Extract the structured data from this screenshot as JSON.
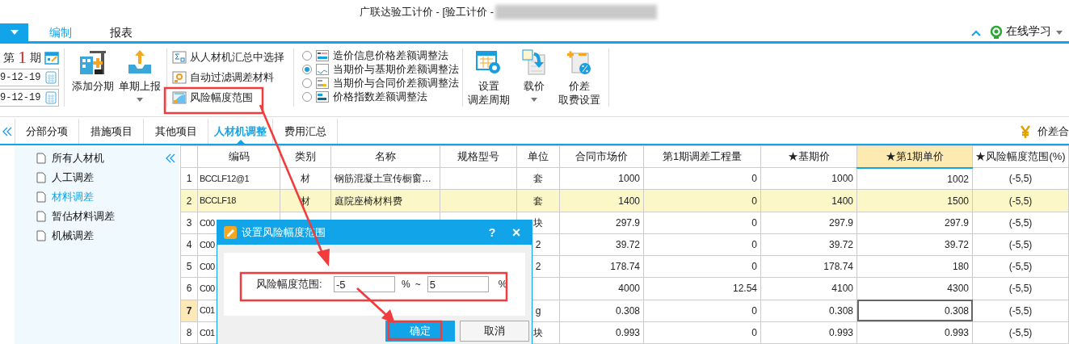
{
  "window": {
    "title": "广联达验工计价 - [验工计价 -"
  },
  "menu_tabs": [
    {
      "label": "编制",
      "selected": true
    },
    {
      "label": "报表",
      "selected": false
    }
  ],
  "help": {
    "label": "在线学习"
  },
  "ribbon": {
    "period": {
      "prefix": "第",
      "number": "1",
      "suffix": "期",
      "dates": [
        "9-12-19",
        "9-12-19"
      ]
    },
    "buttons": [
      {
        "lines": [
          "添加分期"
        ],
        "dropdown": false
      },
      {
        "lines": [
          "单期上报"
        ],
        "dropdown": true
      }
    ],
    "commands": [
      {
        "label": "从人材机汇总中选择"
      },
      {
        "label": "自动过滤调差材料"
      },
      {
        "label": "风险幅度范围"
      }
    ],
    "methods": [
      {
        "label": "造价信息价格差额调整法",
        "selected": false
      },
      {
        "label": "当期价与基期价差额调整法",
        "selected": true
      },
      {
        "label": "当期价与合同价差额调整法",
        "selected": false
      },
      {
        "label": "价格指数差额调整法",
        "selected": false
      }
    ],
    "settings": [
      {
        "lines": [
          "设置",
          "调差周期"
        ],
        "dropdown": false
      },
      {
        "lines": [
          "载价"
        ],
        "dropdown": true
      },
      {
        "lines": [
          "价差",
          "取费设置"
        ],
        "dropdown": false
      }
    ]
  },
  "tabs": [
    {
      "label": "分部分项",
      "selected": false
    },
    {
      "label": "措施项目",
      "selected": false
    },
    {
      "label": "其他项目",
      "selected": false
    },
    {
      "label": "人材机调整",
      "selected": true
    },
    {
      "label": "费用汇总",
      "selected": false
    }
  ],
  "summary": {
    "label": "价差合"
  },
  "sidebar": {
    "items": [
      {
        "label": "所有人材机",
        "selected": false
      },
      {
        "label": "人工调差",
        "selected": false
      },
      {
        "label": "材料调差",
        "selected": true
      },
      {
        "label": "暂估材料调差",
        "selected": false
      },
      {
        "label": "机械调差",
        "selected": false
      }
    ]
  },
  "table": {
    "columns": [
      {
        "label": "编码",
        "selected": false
      },
      {
        "label": "类别",
        "selected": false
      },
      {
        "label": "名称",
        "selected": false
      },
      {
        "label": "规格型号",
        "selected": false
      },
      {
        "label": "单位",
        "selected": false
      },
      {
        "label": "合同市场价",
        "selected": false
      },
      {
        "label": "第1期调差工程量",
        "selected": false
      },
      {
        "label": "★基期价",
        "selected": false
      },
      {
        "label": "★第1期单价",
        "selected": true
      },
      {
        "label": "★风险幅度范围(%)",
        "selected": false
      }
    ],
    "rows": [
      {
        "num": "1",
        "selected": false,
        "current": false,
        "cells": [
          "BCCLF12@1",
          "材",
          "钢筋混凝土宣传橱窗…",
          "",
          "套",
          "1000",
          "0",
          "1000",
          "1002",
          "(-5,5)"
        ]
      },
      {
        "num": "2",
        "selected": true,
        "current": false,
        "cells": [
          "BCCLF18",
          "材",
          "庭院座椅材料费",
          "",
          "套",
          "1400",
          "0",
          "1400",
          "1500",
          "(-5,5)"
        ]
      },
      {
        "num": "3",
        "selected": false,
        "current": false,
        "cells": [
          "C00",
          null,
          null,
          null,
          "块",
          "297.9",
          "0",
          "297.9",
          "297.9",
          "(-5,5)"
        ]
      },
      {
        "num": "4",
        "selected": false,
        "current": false,
        "cells": [
          "C00",
          null,
          null,
          null,
          "2",
          "39.72",
          "0",
          "39.72",
          "39.72",
          "(-5,5)"
        ]
      },
      {
        "num": "5",
        "selected": false,
        "current": false,
        "cells": [
          "C00",
          null,
          null,
          null,
          "2",
          "178.74",
          "0",
          "178.74",
          "180",
          "(-5,5)"
        ]
      },
      {
        "num": "6",
        "selected": false,
        "current": false,
        "cells": [
          "C00",
          null,
          null,
          null,
          null,
          "4000",
          "12.54",
          "4100",
          "4300",
          "(-5,5)"
        ]
      },
      {
        "num": "7",
        "selected": false,
        "current": true,
        "cells": [
          "C01",
          null,
          null,
          null,
          "g",
          "0.308",
          "0",
          "0.308",
          "0.308",
          "(-5,5)"
        ]
      },
      {
        "num": "8",
        "selected": false,
        "current": false,
        "cells": [
          "C01",
          null,
          null,
          null,
          "块",
          "0.993",
          "0",
          "0.993",
          "0.993",
          "(-5,5)"
        ]
      }
    ]
  },
  "dialog": {
    "title": "设置风险幅度范围",
    "help": "?",
    "close": "×",
    "label": "风险幅度范围:",
    "min": "-5",
    "min_unit": "%",
    "separator": "~",
    "max": "5",
    "max_unit": "%",
    "buttons": [
      {
        "label": "确定",
        "kind": "primary"
      },
      {
        "label": "取消",
        "kind": "secondary"
      }
    ]
  }
}
